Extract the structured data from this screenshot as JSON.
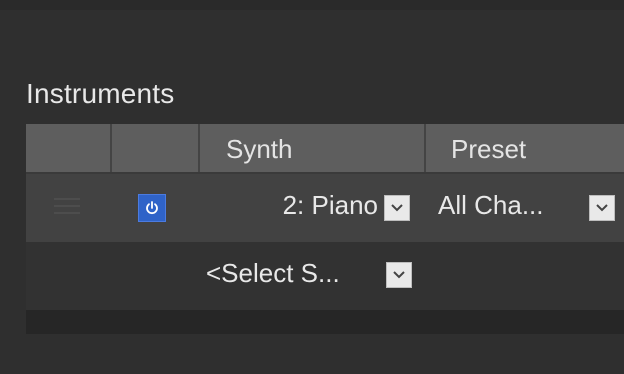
{
  "section": {
    "title": "Instruments"
  },
  "table": {
    "headers": [
      "",
      "",
      "Synth",
      "Preset"
    ]
  },
  "instrument_row": {
    "synth": "2: Piano",
    "preset": "All Cha...",
    "power_on": true
  },
  "select_row": {
    "placeholder": "<Select S..."
  },
  "colors": {
    "accent": "#2f63c8",
    "header_bg": "#5e5e5e",
    "row_bg": "#424242",
    "panel_bg": "#2f2f2f"
  },
  "icons": {
    "power": "power-icon",
    "dropdown": "chevron-down-icon",
    "drag": "drag-handle-icon"
  }
}
